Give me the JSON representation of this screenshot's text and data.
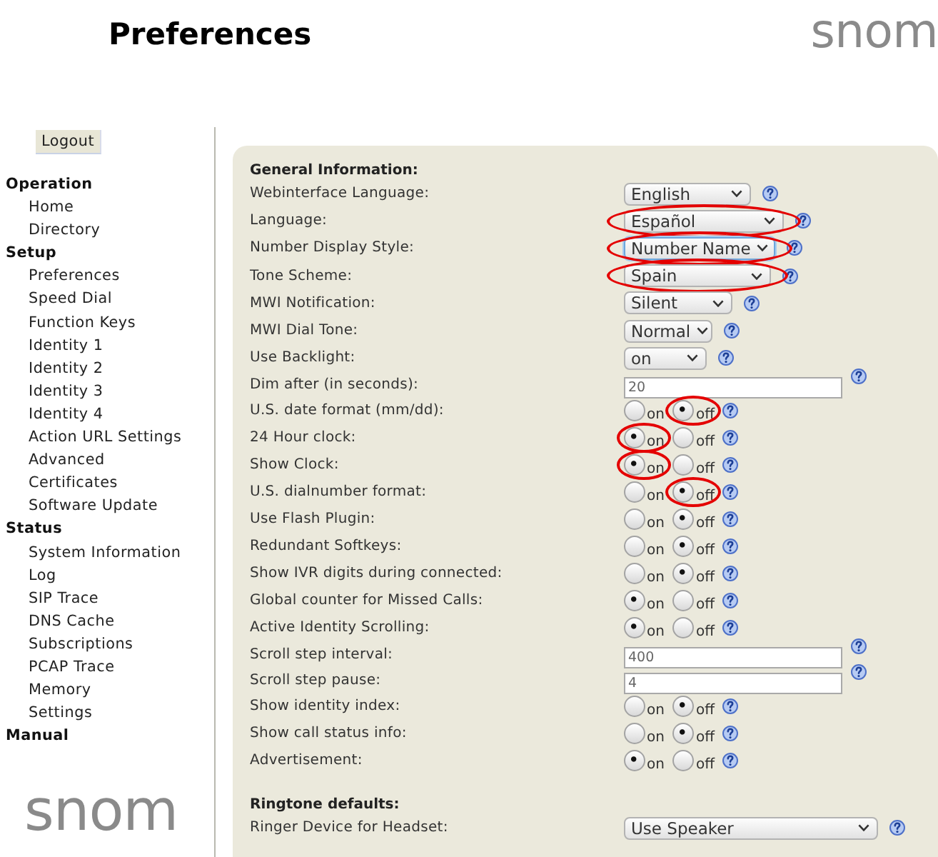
{
  "header": {
    "title": "Preferences",
    "logo": "snom"
  },
  "sidebar": {
    "logout_button": "Logout",
    "groups": [
      {
        "heading": "Operation",
        "items": [
          "Home",
          "Directory"
        ]
      },
      {
        "heading": "Setup",
        "items": [
          "Preferences",
          "Speed Dial",
          "Function Keys",
          "Identity 1",
          "Identity 2",
          "Identity 3",
          "Identity 4",
          "Action URL Settings",
          "Advanced",
          "Certificates",
          "Software Update"
        ]
      },
      {
        "heading": "Status",
        "items": [
          "System Information",
          "Log",
          "SIP Trace",
          "DNS Cache",
          "Subscriptions",
          "PCAP Trace",
          "Memory",
          "Settings"
        ]
      },
      {
        "heading": "Manual"
      }
    ],
    "logo": "snom"
  },
  "sections": [
    {
      "heading": "General Information:",
      "rows": [
        {
          "label": "Webinterface Language:",
          "kind": "select",
          "value": "English",
          "circled": false,
          "focused": false
        },
        {
          "label": "Language:",
          "kind": "select",
          "value": "Español",
          "circled": true,
          "focused": false
        },
        {
          "label": "Number Display Style:",
          "kind": "select",
          "value": "Number Name",
          "circled": true,
          "focused": true
        },
        {
          "label": "Tone Scheme:",
          "kind": "select",
          "value": "Spain",
          "circled": true,
          "focused": false
        },
        {
          "label": "MWI Notification:",
          "kind": "select",
          "value": "Silent",
          "circled": false,
          "focused": false
        },
        {
          "label": "MWI Dial Tone:",
          "kind": "select",
          "value": "Normal",
          "circled": false,
          "focused": false
        },
        {
          "label": "Use Backlight:",
          "kind": "select",
          "value": "on",
          "circled": false,
          "focused": false
        },
        {
          "label": "Dim after (in seconds):",
          "kind": "text",
          "value": "20",
          "circled": false,
          "focused": false
        },
        {
          "label": "U.S. date format (mm/dd):",
          "kind": "radio",
          "options": [
            {
              "label": "on",
              "selected": false
            },
            {
              "label": "off",
              "selected": true
            }
          ],
          "circled": true,
          "focused": false
        },
        {
          "label": "24 Hour clock:",
          "kind": "radio",
          "options": [
            {
              "label": "on",
              "selected": true
            },
            {
              "label": "off",
              "selected": false
            }
          ],
          "circled": true,
          "focused": false
        },
        {
          "label": "Show Clock:",
          "kind": "radio",
          "options": [
            {
              "label": "on",
              "selected": true
            },
            {
              "label": "off",
              "selected": false
            }
          ],
          "circled": true,
          "focused": false
        },
        {
          "label": "U.S. dialnumber format:",
          "kind": "radio",
          "options": [
            {
              "label": "on",
              "selected": false
            },
            {
              "label": "off",
              "selected": true
            }
          ],
          "circled": true,
          "focused": false
        },
        {
          "label": "Use Flash Plugin:",
          "kind": "radio",
          "options": [
            {
              "label": "on",
              "selected": false
            },
            {
              "label": "off",
              "selected": true
            }
          ],
          "circled": false,
          "focused": false
        },
        {
          "label": "Redundant Softkeys:",
          "kind": "radio",
          "options": [
            {
              "label": "on",
              "selected": false
            },
            {
              "label": "off",
              "selected": true
            }
          ],
          "circled": false,
          "focused": false
        },
        {
          "label": "Show IVR digits during connected:",
          "kind": "radio",
          "options": [
            {
              "label": "on",
              "selected": false
            },
            {
              "label": "off",
              "selected": true
            }
          ],
          "circled": false,
          "focused": false
        },
        {
          "label": "Global counter for Missed Calls:",
          "kind": "radio",
          "options": [
            {
              "label": "on",
              "selected": true
            },
            {
              "label": "off",
              "selected": false
            }
          ],
          "circled": false,
          "focused": false
        },
        {
          "label": "Active Identity Scrolling:",
          "kind": "radio",
          "options": [
            {
              "label": "on",
              "selected": true
            },
            {
              "label": "off",
              "selected": false
            }
          ],
          "circled": false,
          "focused": false
        },
        {
          "label": "Scroll step interval:",
          "kind": "text",
          "value": "400",
          "circled": false,
          "focused": false
        },
        {
          "label": "Scroll step pause:",
          "kind": "text",
          "value": "4",
          "circled": false,
          "focused": false
        },
        {
          "label": "Show identity index:",
          "kind": "radio",
          "options": [
            {
              "label": "on",
              "selected": false
            },
            {
              "label": "off",
              "selected": true
            }
          ],
          "circled": false,
          "focused": false
        },
        {
          "label": "Show call status info:",
          "kind": "radio",
          "options": [
            {
              "label": "on",
              "selected": false
            },
            {
              "label": "off",
              "selected": true
            }
          ],
          "circled": false,
          "focused": false
        },
        {
          "label": "Advertisement:",
          "kind": "radio",
          "options": [
            {
              "label": "on",
              "selected": true
            },
            {
              "label": "off",
              "selected": false
            }
          ],
          "circled": false,
          "focused": false
        }
      ]
    },
    {
      "heading": "Ringtone defaults:",
      "rows": [
        {
          "label": "Ringer Device for Headset:",
          "kind": "select",
          "value": "Use Speaker",
          "circled": false,
          "focused": false
        }
      ]
    }
  ]
}
